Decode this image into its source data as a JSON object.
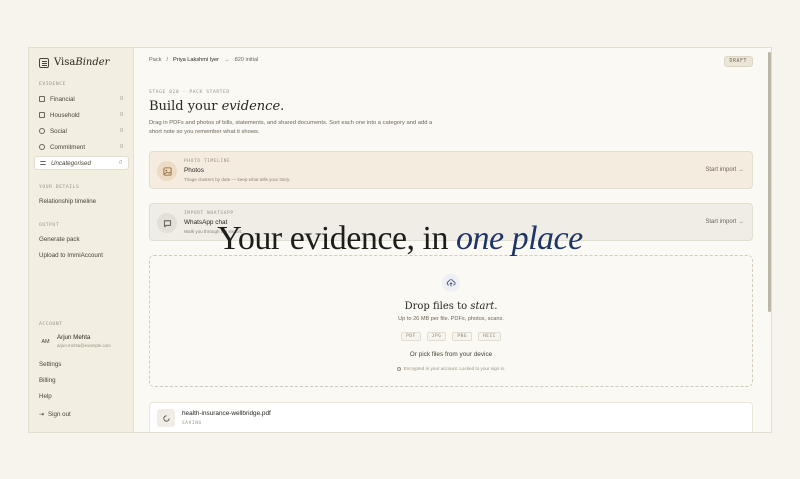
{
  "brand": {
    "part1": "Visa",
    "part2": "Binder"
  },
  "sidebar": {
    "evidence_label": "EVIDENCE",
    "items": [
      {
        "label": "Financial",
        "count": "0"
      },
      {
        "label": "Household",
        "count": "0"
      },
      {
        "label": "Social",
        "count": "0"
      },
      {
        "label": "Commitment",
        "count": "0"
      },
      {
        "label": "Uncategorised",
        "count": "0"
      }
    ],
    "your_details_label": "YOUR DETAILS",
    "relationship": "Relationship timeline",
    "output_label": "OUTPUT",
    "generate": "Generate pack",
    "upload": "Upload to ImmiAccount",
    "account_label": "ACCOUNT",
    "user": {
      "initials": "AM",
      "name": "Arjun Mehta",
      "email": "arjun.mehta@example.com"
    },
    "settings": "Settings",
    "billing": "Billing",
    "help": "Help",
    "signout": "Sign out"
  },
  "topbar": {
    "crumb1": "Pack",
    "sep": "/",
    "crumb2": "Priya Lakshmi Iyer",
    "arrow": "→",
    "crumb3": "820 initial",
    "badge": "DRAFT"
  },
  "main": {
    "stage": "STAGE 820 · PACK STARTED",
    "title_plain": "Build your ",
    "title_em": "evidence.",
    "desc": "Drag in PDFs and photos of bills, statements, and shared documents. Sort each one into a category and add a short note so you remember what it shows."
  },
  "cards": {
    "photos": {
      "kicker": "PHOTO TIMELINE",
      "title": "Photos",
      "sub": "Triage clusters by date — keep what tells your story.",
      "action": "Start import →"
    },
    "whatsapp": {
      "kicker": "IMPORT WHATSAPP",
      "title": "WhatsApp chat",
      "sub": "Walk you through the export.",
      "action": "Start import →"
    }
  },
  "drop": {
    "title_plain": "Drop files to ",
    "title_em": "start.",
    "sub": "Up to 26 MB per file. PDFs, photos, scans.",
    "types": [
      "PDF",
      "JPG",
      "PNG",
      "HEIC"
    ],
    "pick": "Or pick files from your device",
    "enc": "Encrypted in your account. Locked to your sign in."
  },
  "file": {
    "name": "health-insurance-wellbridge.pdf",
    "status": "SAVING"
  },
  "overlay": {
    "plain": "Your evidence, in ",
    "em": "one place"
  }
}
